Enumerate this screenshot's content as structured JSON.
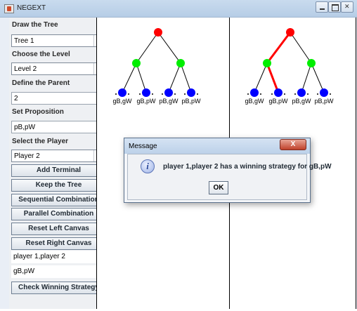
{
  "window": {
    "title": "NEGEXT"
  },
  "panel": {
    "draw_tree_label": "Draw the Tree",
    "tree_select": "Tree 1",
    "level_label": "Choose the Level",
    "level_select": "Level 2",
    "parent_label": "Define the Parent",
    "parent_value": "2",
    "proposition_label": "Set Proposition",
    "proposition_value": "pB,pW",
    "player_label": "Select the Player",
    "player_select": "Player 2",
    "buttons": {
      "add_terminal": "Add Terminal",
      "keep_tree": "Keep the Tree",
      "sequential": "Sequential Combination",
      "parallel": "Parallel Combination",
      "reset_left": "Reset Left Canvas",
      "reset_right": "Reset Right Canvas",
      "check": "Check Winning Strategy"
    },
    "players_value": "player 1,player 2",
    "result_value": "gB,pW"
  },
  "left_tree": {
    "leaf_labels": [
      "gB,gW",
      "gB,pW",
      "pB,gW",
      "pB,pW"
    ],
    "colors": {
      "root": "#ff0000",
      "level1": "#00ee00",
      "leaf": "#0000ff",
      "edge": "#000000"
    }
  },
  "right_tree": {
    "leaf_labels": [
      "gB,gW",
      "gB,pW",
      "pB,gW",
      "pB,pW"
    ],
    "colors": {
      "root": "#ff0000",
      "level1": "#00ee00",
      "leaf": "#0000ff",
      "edge": "#000000",
      "highlight": "#ff0000"
    }
  },
  "dialog": {
    "title": "Message",
    "close_label": "X",
    "message": "player 1,player 2 has a winning strategy for gB,pW",
    "ok_label": "OK",
    "icon": "info-icon"
  }
}
